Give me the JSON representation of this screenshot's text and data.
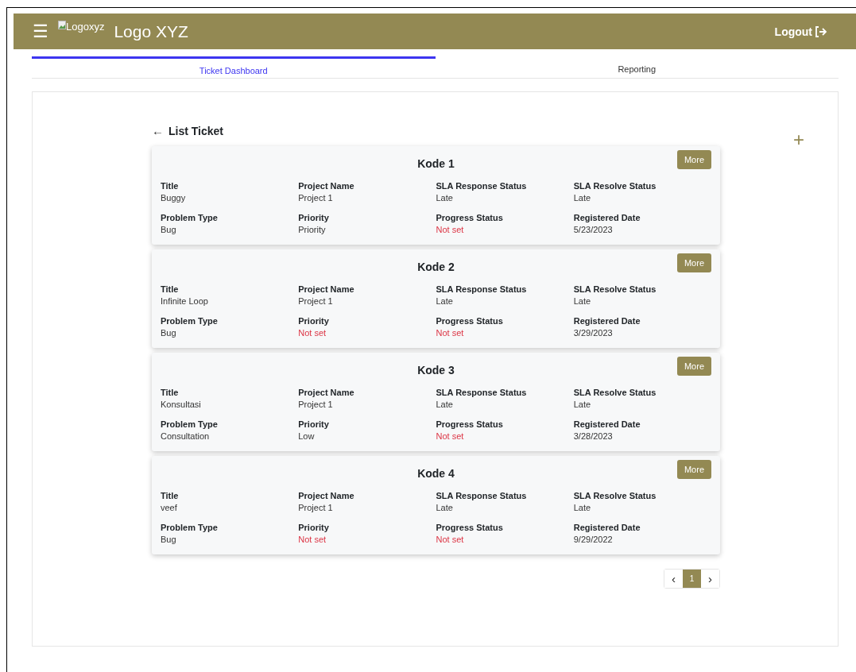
{
  "header": {
    "menu_glyph": "☰",
    "logo_alt": "Logoxyz",
    "brand": "Logo XYZ",
    "logout": "Logout"
  },
  "tabs": [
    {
      "label": "Ticket Dashboard",
      "selected": true
    },
    {
      "label": "Reporting",
      "selected": false
    }
  ],
  "list": {
    "back_glyph": "←",
    "title": "List Ticket",
    "add_glyph": "+"
  },
  "tickets": [
    {
      "code": "Kode 1",
      "button": "More",
      "fields": [
        {
          "label": "Title",
          "value": "Buggy",
          "unset": false
        },
        {
          "label": "Project Name",
          "value": "Project 1",
          "unset": false
        },
        {
          "label": "SLA Response Status",
          "value": "Late",
          "unset": false
        },
        {
          "label": "SLA Resolve Status",
          "value": "Late",
          "unset": false
        },
        {
          "label": "Problem Type",
          "value": "Bug",
          "unset": false
        },
        {
          "label": "Priority",
          "value": "Priority",
          "unset": false
        },
        {
          "label": "Progress Status",
          "value": "Not set",
          "unset": true
        },
        {
          "label": "Registered Date",
          "value": "5/23/2023",
          "unset": false
        }
      ]
    },
    {
      "code": "Kode 2",
      "button": "More",
      "fields": [
        {
          "label": "Title",
          "value": "Infinite Loop",
          "unset": false
        },
        {
          "label": "Project Name",
          "value": "Project 1",
          "unset": false
        },
        {
          "label": "SLA Response Status",
          "value": "Late",
          "unset": false
        },
        {
          "label": "SLA Resolve Status",
          "value": "Late",
          "unset": false
        },
        {
          "label": "Problem Type",
          "value": "Bug",
          "unset": false
        },
        {
          "label": "Priority",
          "value": "Not set",
          "unset": true
        },
        {
          "label": "Progress Status",
          "value": "Not set",
          "unset": true
        },
        {
          "label": "Registered Date",
          "value": "3/29/2023",
          "unset": false
        }
      ]
    },
    {
      "code": "Kode 3",
      "button": "More",
      "fields": [
        {
          "label": "Title",
          "value": "Konsultasi",
          "unset": false
        },
        {
          "label": "Project Name",
          "value": "Project 1",
          "unset": false
        },
        {
          "label": "SLA Response Status",
          "value": "Late",
          "unset": false
        },
        {
          "label": "SLA Resolve Status",
          "value": "Late",
          "unset": false
        },
        {
          "label": "Problem Type",
          "value": "Consultation",
          "unset": false
        },
        {
          "label": "Priority",
          "value": "Low",
          "unset": false
        },
        {
          "label": "Progress Status",
          "value": "Not set",
          "unset": true
        },
        {
          "label": "Registered Date",
          "value": "3/28/2023",
          "unset": false
        }
      ]
    },
    {
      "code": "Kode 4",
      "button": "More",
      "fields": [
        {
          "label": "Title",
          "value": "veef",
          "unset": false
        },
        {
          "label": "Project Name",
          "value": "Project 1",
          "unset": false
        },
        {
          "label": "SLA Response Status",
          "value": "Late",
          "unset": false
        },
        {
          "label": "SLA Resolve Status",
          "value": "Late",
          "unset": false
        },
        {
          "label": "Problem Type",
          "value": "Bug",
          "unset": false
        },
        {
          "label": "Priority",
          "value": "Not set",
          "unset": true
        },
        {
          "label": "Progress Status",
          "value": "Not set",
          "unset": true
        },
        {
          "label": "Registered Date",
          "value": "9/29/2022",
          "unset": false
        }
      ]
    }
  ],
  "pagination": {
    "prev": "‹",
    "next": "›",
    "pages": [
      {
        "label": "1",
        "selected": true
      }
    ]
  }
}
